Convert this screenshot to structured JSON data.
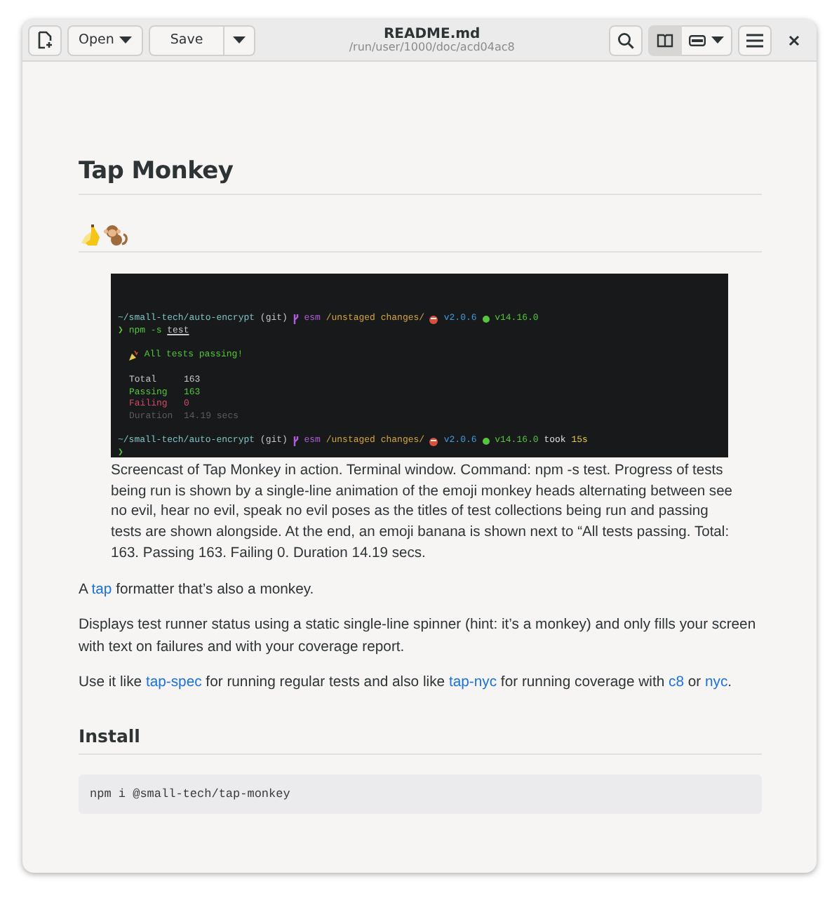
{
  "window": {
    "title": "README.md",
    "subtitle": "/run/user/1000/doc/acd04ac8"
  },
  "toolbar": {
    "open_label": "Open",
    "save_label": "Save",
    "reader_view_selected": true
  },
  "document": {
    "title": "Tap Monkey",
    "terminal": {
      "lines": [
        {
          "blank_before": false,
          "indent": false,
          "segments": [
            {
              "kind": "text",
              "text": "~/small-tech/auto-encrypt",
              "color": "#7fc4c4"
            },
            {
              "kind": "text",
              "text": " (git) ",
              "color": "#c8c8c8"
            },
            {
              "kind": "branch",
              "color": "#b05cd8"
            },
            {
              "kind": "text",
              "text": " esm",
              "color": "#b05cd8"
            },
            {
              "kind": "text",
              "text": " /unstaged changes/ ",
              "color": "#d6a540"
            },
            {
              "kind": "ball",
              "color": "#d8503c"
            },
            {
              "kind": "text",
              "text": " v2.0.6 ",
              "color": "#3d9be0"
            },
            {
              "kind": "dot",
              "color": "#56c43c"
            },
            {
              "kind": "text",
              "text": " v14.16.0",
              "color": "#56c43c"
            }
          ]
        },
        {
          "blank_before": false,
          "indent": false,
          "segments": [
            {
              "kind": "text",
              "text": "❯ npm -s ",
              "color": "#56c43c"
            },
            {
              "kind": "text",
              "text": "test",
              "color": "#c8c8c8",
              "underline": true
            }
          ]
        },
        {
          "blank_before": true,
          "indent": true,
          "segments": [
            {
              "kind": "party",
              "color": "#e8c84a"
            },
            {
              "kind": "text",
              "text": " All tests passing!",
              "color": "#56c43c"
            }
          ]
        },
        {
          "blank_before": true,
          "indent": true,
          "segments": [
            {
              "kind": "text",
              "text": "Total     163",
              "color": "#c8c8c8"
            }
          ]
        },
        {
          "blank_before": false,
          "indent": true,
          "segments": [
            {
              "kind": "text",
              "text": "Passing   163",
              "color": "#56c43c"
            }
          ]
        },
        {
          "blank_before": false,
          "indent": true,
          "segments": [
            {
              "kind": "text",
              "text": "Failing   0",
              "color": "#d04a6a"
            }
          ]
        },
        {
          "blank_before": false,
          "indent": true,
          "segments": [
            {
              "kind": "text",
              "text": "Duration  14.19 secs",
              "color": "#5c5c5c"
            }
          ]
        },
        {
          "blank_before": true,
          "indent": false,
          "segments": [
            {
              "kind": "text",
              "text": "~/small-tech/auto-encrypt",
              "color": "#7fc4c4"
            },
            {
              "kind": "text",
              "text": " (git) ",
              "color": "#c8c8c8"
            },
            {
              "kind": "branch",
              "color": "#b05cd8"
            },
            {
              "kind": "text",
              "text": " esm",
              "color": "#b05cd8"
            },
            {
              "kind": "text",
              "text": " /unstaged changes/ ",
              "color": "#d6a540"
            },
            {
              "kind": "ball",
              "color": "#d8503c"
            },
            {
              "kind": "text",
              "text": " v2.0.6 ",
              "color": "#3d9be0"
            },
            {
              "kind": "dot",
              "color": "#56c43c"
            },
            {
              "kind": "text",
              "text": " v14.16.0",
              "color": "#56c43c"
            },
            {
              "kind": "text",
              "text": " took ",
              "color": "#e0e0e0"
            },
            {
              "kind": "text",
              "text": "15s",
              "color": "#e8c84a"
            }
          ]
        },
        {
          "blank_before": false,
          "indent": false,
          "segments": [
            {
              "kind": "text",
              "text": "❯",
              "color": "#56c43c"
            }
          ]
        }
      ]
    },
    "caption": "Screencast of Tap Monkey in action. Terminal window. Command: npm -s test. Progress of tests being run is shown by a single-line animation of the emoji monkey heads alternating between see no evil, hear no evil, speak no evil poses as the titles of test collections being run and passing tests are shown alongside. At the end, an emoji banana is shown next to “All tests passing. Total: 163. Passing 163. Failing 0. Duration 14.19 secs.",
    "paragraphs": [
      [
        {
          "kind": "text",
          "text": "A "
        },
        {
          "kind": "link",
          "text": "tap"
        },
        {
          "kind": "text",
          "text": " formatter that’s also a monkey."
        }
      ],
      [
        {
          "kind": "text",
          "text": "Displays test runner status using a static single-line spinner (hint: it’s a monkey) and only fills your screen with text on failures and with your coverage report."
        }
      ],
      [
        {
          "kind": "text",
          "text": "Use it like "
        },
        {
          "kind": "link",
          "text": "tap-spec"
        },
        {
          "kind": "text",
          "text": " for running regular tests and also like "
        },
        {
          "kind": "link",
          "text": "tap-nyc"
        },
        {
          "kind": "text",
          "text": " for running coverage with "
        },
        {
          "kind": "link",
          "text": "c8"
        },
        {
          "kind": "text",
          "text": " or "
        },
        {
          "kind": "link",
          "text": "nyc"
        },
        {
          "kind": "text",
          "text": "."
        }
      ]
    ],
    "install_heading": "Install",
    "install_code": "npm i @small-tech/tap-monkey"
  }
}
